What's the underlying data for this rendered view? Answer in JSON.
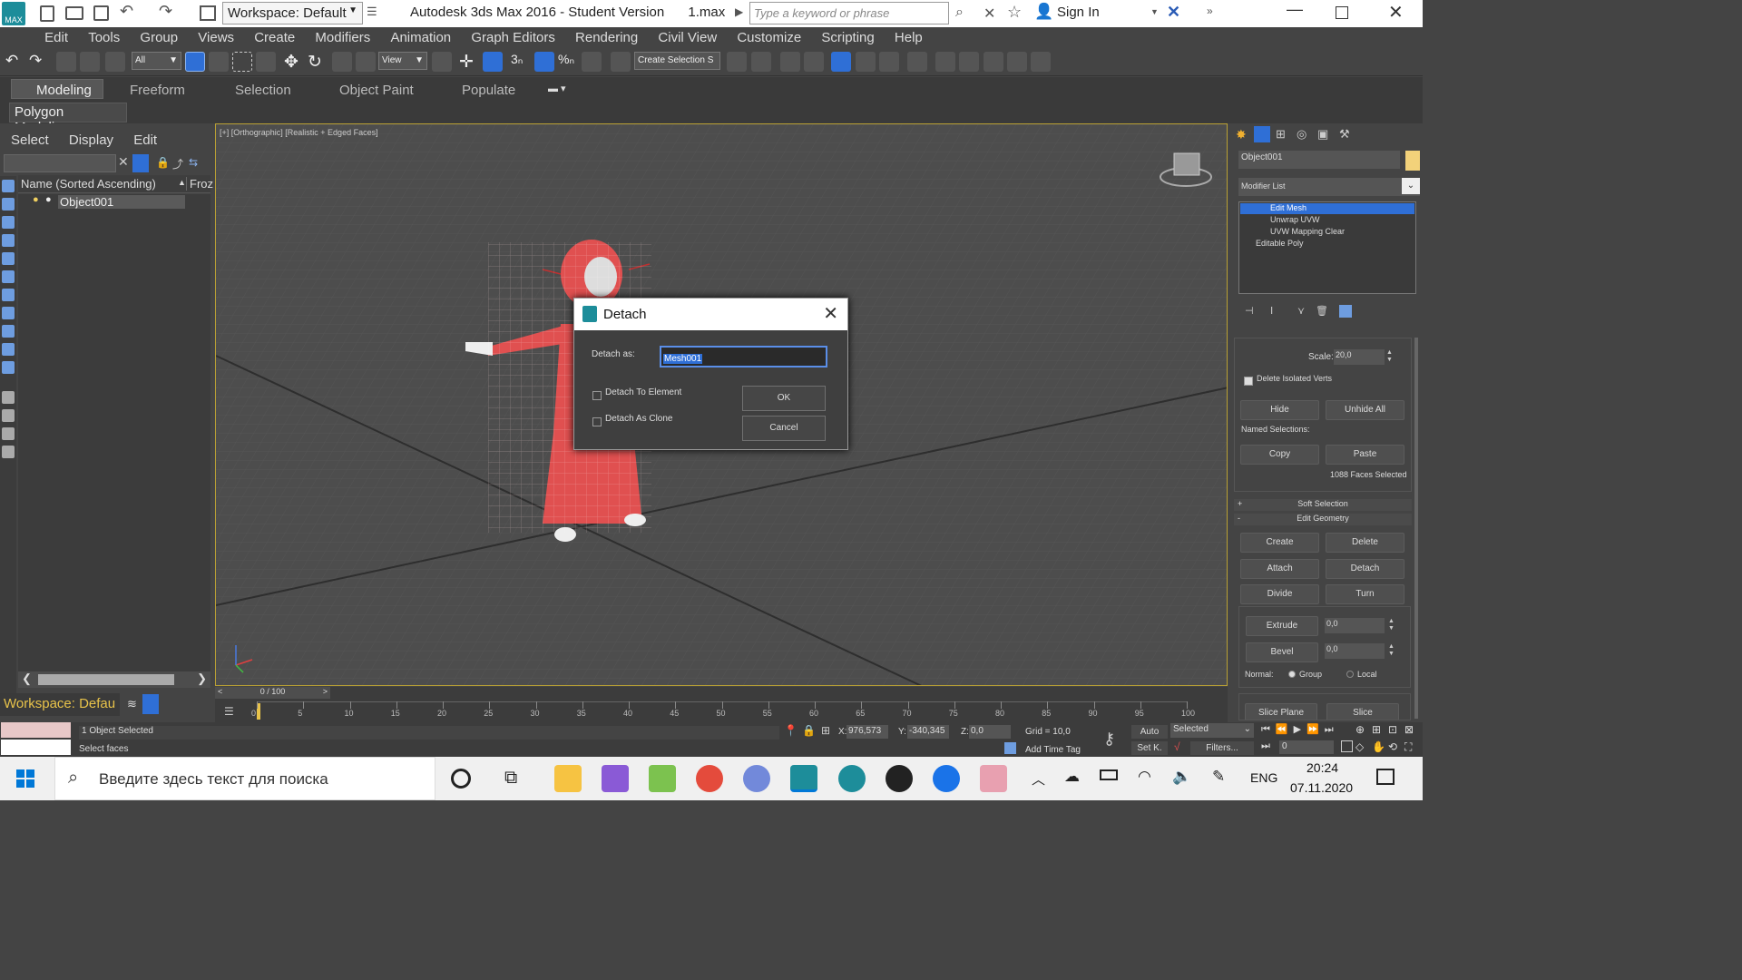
{
  "titlebar": {
    "workspace": "Workspace: Default",
    "title": "Autodesk 3ds Max 2016 - Student Version",
    "filename": "1.max",
    "search_placeholder": "Type a keyword or phrase",
    "sign_in": "Sign In"
  },
  "menu": [
    "Edit",
    "Tools",
    "Group",
    "Views",
    "Create",
    "Modifiers",
    "Animation",
    "Graph Editors",
    "Rendering",
    "Civil View",
    "Customize",
    "Scripting",
    "Help"
  ],
  "toolbar": {
    "filter_value": "All",
    "refcoord_value": "View",
    "selection_set_placeholder": "Create Selection S"
  },
  "ribbon": {
    "tabs": [
      "Modeling",
      "Freeform",
      "Selection",
      "Object Paint",
      "Populate"
    ],
    "active_tab": "Modeling",
    "subtab": "Polygon Modeling"
  },
  "scene_explorer": {
    "menu": [
      "Select",
      "Display",
      "Edit"
    ],
    "col_name": "Name (Sorted Ascending)",
    "col_frozen": "Froz",
    "object": "Object001",
    "workspace": "Workspace: Defau"
  },
  "viewport": {
    "label": "[+] [Orthographic] [Realistic + Edged Faces]"
  },
  "dialog": {
    "title": "Detach",
    "detach_as_label": "Detach as:",
    "detach_as_value": "Mesh001",
    "option_element": "Detach To Element",
    "option_clone": "Detach As Clone",
    "ok": "OK",
    "cancel": "Cancel"
  },
  "command_panel": {
    "object_name": "Object001",
    "modifier_list": "Modifier List",
    "stack": [
      "Edit Mesh",
      "Unwrap UVW",
      "UVW Mapping Clear",
      "Editable Poly"
    ],
    "scale_label": "Scale:",
    "scale_value": "20,0",
    "delete_isolated": "Delete Isolated Verts",
    "hide": "Hide",
    "unhide_all": "Unhide All",
    "named_selections": "Named Selections:",
    "copy": "Copy",
    "paste": "Paste",
    "faces_selected": "1088 Faces Selected",
    "soft_selection": "Soft Selection",
    "edit_geometry": "Edit Geometry",
    "create": "Create",
    "delete": "Delete",
    "attach": "Attach",
    "detach": "Detach",
    "divide": "Divide",
    "turn": "Turn",
    "extrude": "Extrude",
    "extrude_value": "0,0",
    "bevel": "Bevel",
    "bevel_value": "0,0",
    "normal_label": "Normal:",
    "normal_group": "Group",
    "normal_local": "Local",
    "slice_plane": "Slice Plane",
    "slice": "Slice"
  },
  "timeline": {
    "frame": "0 / 100",
    "ticks": [
      "0",
      "5",
      "10",
      "15",
      "20",
      "25",
      "30",
      "35",
      "40",
      "45",
      "50",
      "55",
      "60",
      "65",
      "70",
      "75",
      "80",
      "85",
      "90",
      "95",
      "100"
    ]
  },
  "status": {
    "selected": "1 Object Selected",
    "prompt": "Select faces",
    "x_label": "X:",
    "x": "976,573",
    "y_label": "Y:",
    "y": "-340,345",
    "z_label": "Z:",
    "z": "0,0",
    "grid": "Grid = 10,0",
    "add_time_tag": "Add Time Tag",
    "auto": "Auto",
    "set_key": "Set K.",
    "selected_dropdown": "Selected",
    "filters": "Filters...",
    "frame_value": "0"
  },
  "taskbar": {
    "search_placeholder": "Введите здесь текст для поиска",
    "lang": "ENG",
    "time": "20:24",
    "date": "07.11.2020"
  },
  "colors": {
    "accent": "#2f6fd6",
    "viewport_border": "#b9a034",
    "mesh": "#e05050"
  }
}
